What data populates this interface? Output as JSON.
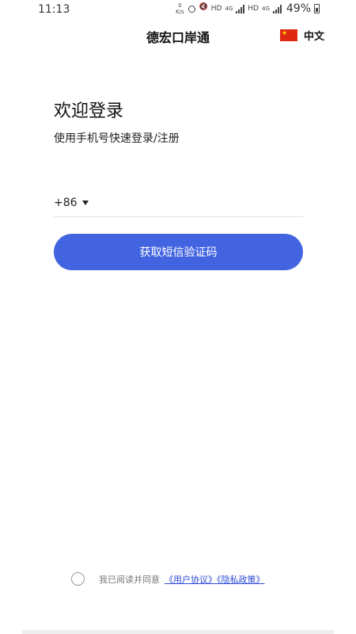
{
  "status_bar": {
    "time": "11:13",
    "speed_value": "0",
    "speed_unit": "K/s",
    "hd1": "HD",
    "net1": "4G",
    "hd2": "HD",
    "net2": "4G",
    "battery": "49%"
  },
  "header": {
    "title": "德宏口岸通",
    "language": "中文",
    "flag_icon": "china-flag-icon"
  },
  "login": {
    "title": "欢迎登录",
    "subtitle": "使用手机号快速登录/注册",
    "country_code": "+86",
    "phone_placeholder": "",
    "phone_value": "",
    "submit_label": "获取短信验证码"
  },
  "agreement": {
    "text": "我已阅读并同意",
    "links": "《用户协议》《隐私政策》"
  },
  "colors": {
    "primary": "#4264e0",
    "link": "#2d4bd6"
  }
}
